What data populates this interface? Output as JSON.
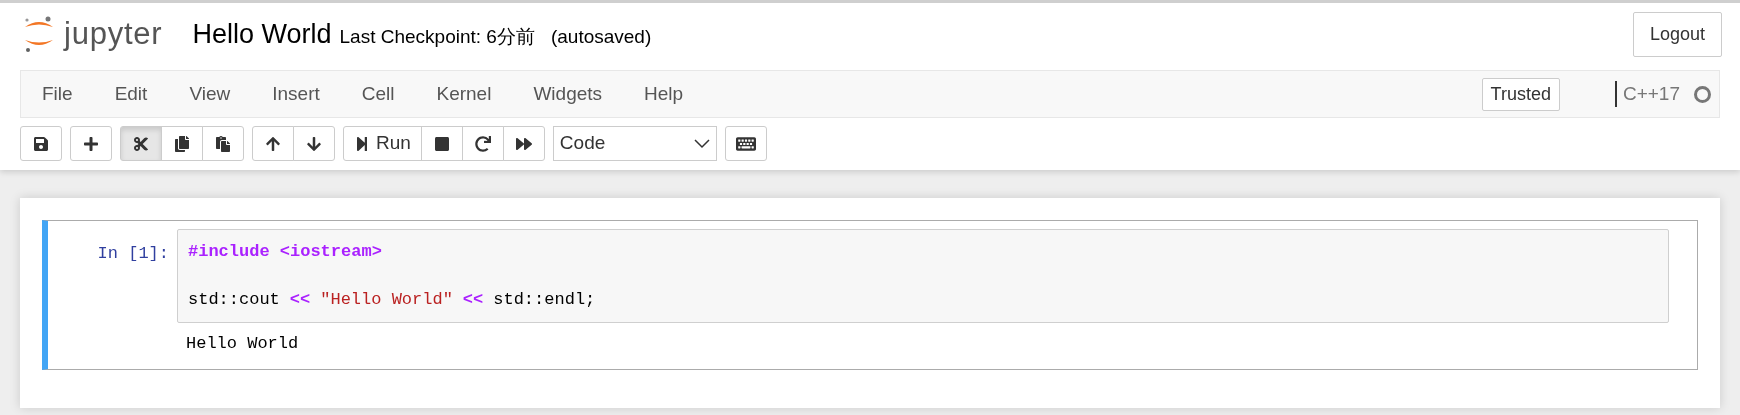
{
  "header": {
    "logo_text": "jupyter",
    "notebook_name": "Hello World",
    "checkpoint": "Last Checkpoint: 6分前",
    "autosave": "(autosaved)",
    "logout": "Logout"
  },
  "menu": [
    "File",
    "Edit",
    "View",
    "Insert",
    "Cell",
    "Kernel",
    "Widgets",
    "Help"
  ],
  "trusted": "Trusted",
  "kernel": {
    "name": "C++17",
    "busy": false
  },
  "toolbar": [
    [
      {
        "kind": "save",
        "selected": false
      }
    ],
    [
      {
        "kind": "insert",
        "selected": false
      }
    ],
    [
      {
        "kind": "cut",
        "selected": true
      },
      {
        "kind": "copy",
        "selected": false
      },
      {
        "kind": "paste",
        "selected": false
      }
    ],
    [
      {
        "kind": "up",
        "selected": false
      },
      {
        "kind": "down",
        "selected": false
      }
    ],
    [
      {
        "kind": "run",
        "label": "Run",
        "selected": false
      },
      {
        "kind": "stop",
        "selected": false
      },
      {
        "kind": "restart",
        "selected": false
      },
      {
        "kind": "run-all",
        "selected": false
      }
    ],
    [
      {
        "kind": "cell-type",
        "value": "Code"
      }
    ],
    [
      {
        "kind": "keyboard",
        "selected": false
      }
    ]
  ],
  "cell": {
    "prompt": "In [1]:",
    "selected": true,
    "lines": [
      {
        "tokens": [
          {
            "kind": "meta",
            "text": "#include <iostream>"
          }
        ]
      },
      {
        "tokens": [
          {
            "kind": "plain",
            "text": "std::cout"
          },
          {
            "kind": "operator",
            "text": "<<"
          },
          {
            "kind": "string",
            "text": "\"Hello World\""
          },
          {
            "kind": "operator",
            "text": "<<"
          },
          {
            "kind": "plain",
            "text": "std::endl;"
          }
        ]
      }
    ],
    "output": "Hello World"
  }
}
